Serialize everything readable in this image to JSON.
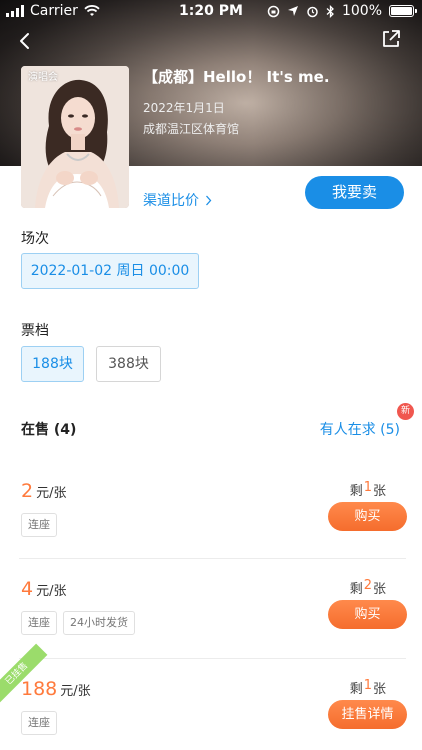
{
  "status_bar": {
    "carrier": "Carrier",
    "time": "1:20 PM",
    "battery": "100%"
  },
  "event": {
    "poster_tag": "演唱会",
    "title": "【成都】Hello！ It's me.",
    "date": "2022年1月1日",
    "venue": "成都温江区体育馆"
  },
  "actions": {
    "compare_label": "渠道比价",
    "sell_label": "我要卖"
  },
  "session": {
    "title": "场次",
    "options": [
      {
        "label": "2022-01-02 周日 00:00",
        "selected": true
      }
    ]
  },
  "tier": {
    "title": "票档",
    "options": [
      {
        "label": "188块",
        "selected": true
      },
      {
        "label": "388块",
        "selected": false
      }
    ]
  },
  "on_sale": {
    "label": "在售 (4)",
    "wanted_label": "有人在求 (5)",
    "new_badge": "新"
  },
  "listings": [
    {
      "price": "2",
      "unit": "元/张",
      "tags": [
        "连座"
      ],
      "remain_prefix": "剩",
      "remain_count": "1",
      "remain_suffix": "张",
      "button": "购买"
    },
    {
      "price": "4",
      "unit": "元/张",
      "tags": [
        "连座",
        "24小时发货"
      ],
      "remain_prefix": "剩",
      "remain_count": "2",
      "remain_suffix": "张",
      "button": "购买"
    },
    {
      "ribbon": "已挂售",
      "price": "188",
      "unit": "元/张",
      "tags": [
        "连座"
      ],
      "remain_prefix": "剩",
      "remain_count": "1",
      "remain_suffix": "张",
      "button": "挂售详情"
    }
  ],
  "colors": {
    "accent_blue": "#1a8ee6",
    "price_orange": "#ff7a3c",
    "badge_red": "#f0574f",
    "ribbon_green": "#9bdc6b"
  },
  "icons": {
    "back": "chevron-left-icon",
    "share": "share-icon",
    "compare_arrow": "chevron-right-icon"
  }
}
